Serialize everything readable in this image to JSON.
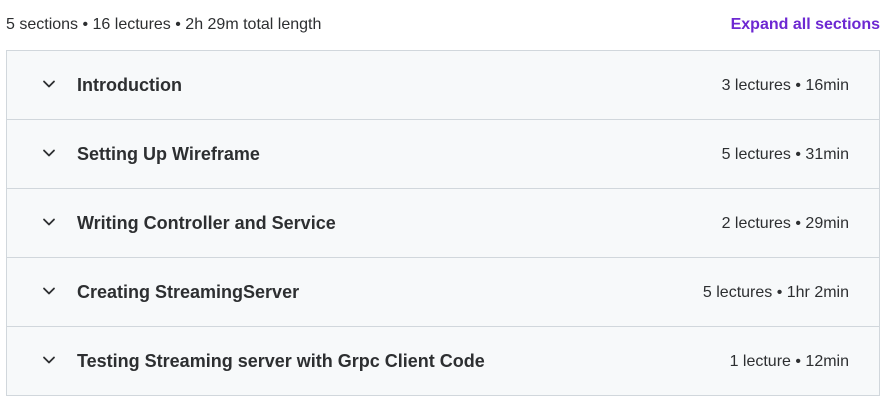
{
  "curriculum": {
    "summary": "5 sections • 16 lectures • 2h 29m total length",
    "expand_label": "Expand all sections",
    "accent_color": "#6d28d2",
    "sections": [
      {
        "title": "Introduction",
        "meta": "3 lectures • 16min",
        "icon": "chevron-down-icon"
      },
      {
        "title": "Setting Up Wireframe",
        "meta": "5 lectures • 31min",
        "icon": "chevron-down-icon"
      },
      {
        "title": "Writing Controller and Service",
        "meta": "2 lectures • 29min",
        "icon": "chevron-down-icon"
      },
      {
        "title": "Creating StreamingServer",
        "meta": "5 lectures • 1hr 2min",
        "icon": "chevron-down-icon"
      },
      {
        "title": "Testing Streaming server with Grpc Client Code",
        "meta": "1 lecture • 12min",
        "icon": "chevron-down-icon"
      }
    ]
  }
}
